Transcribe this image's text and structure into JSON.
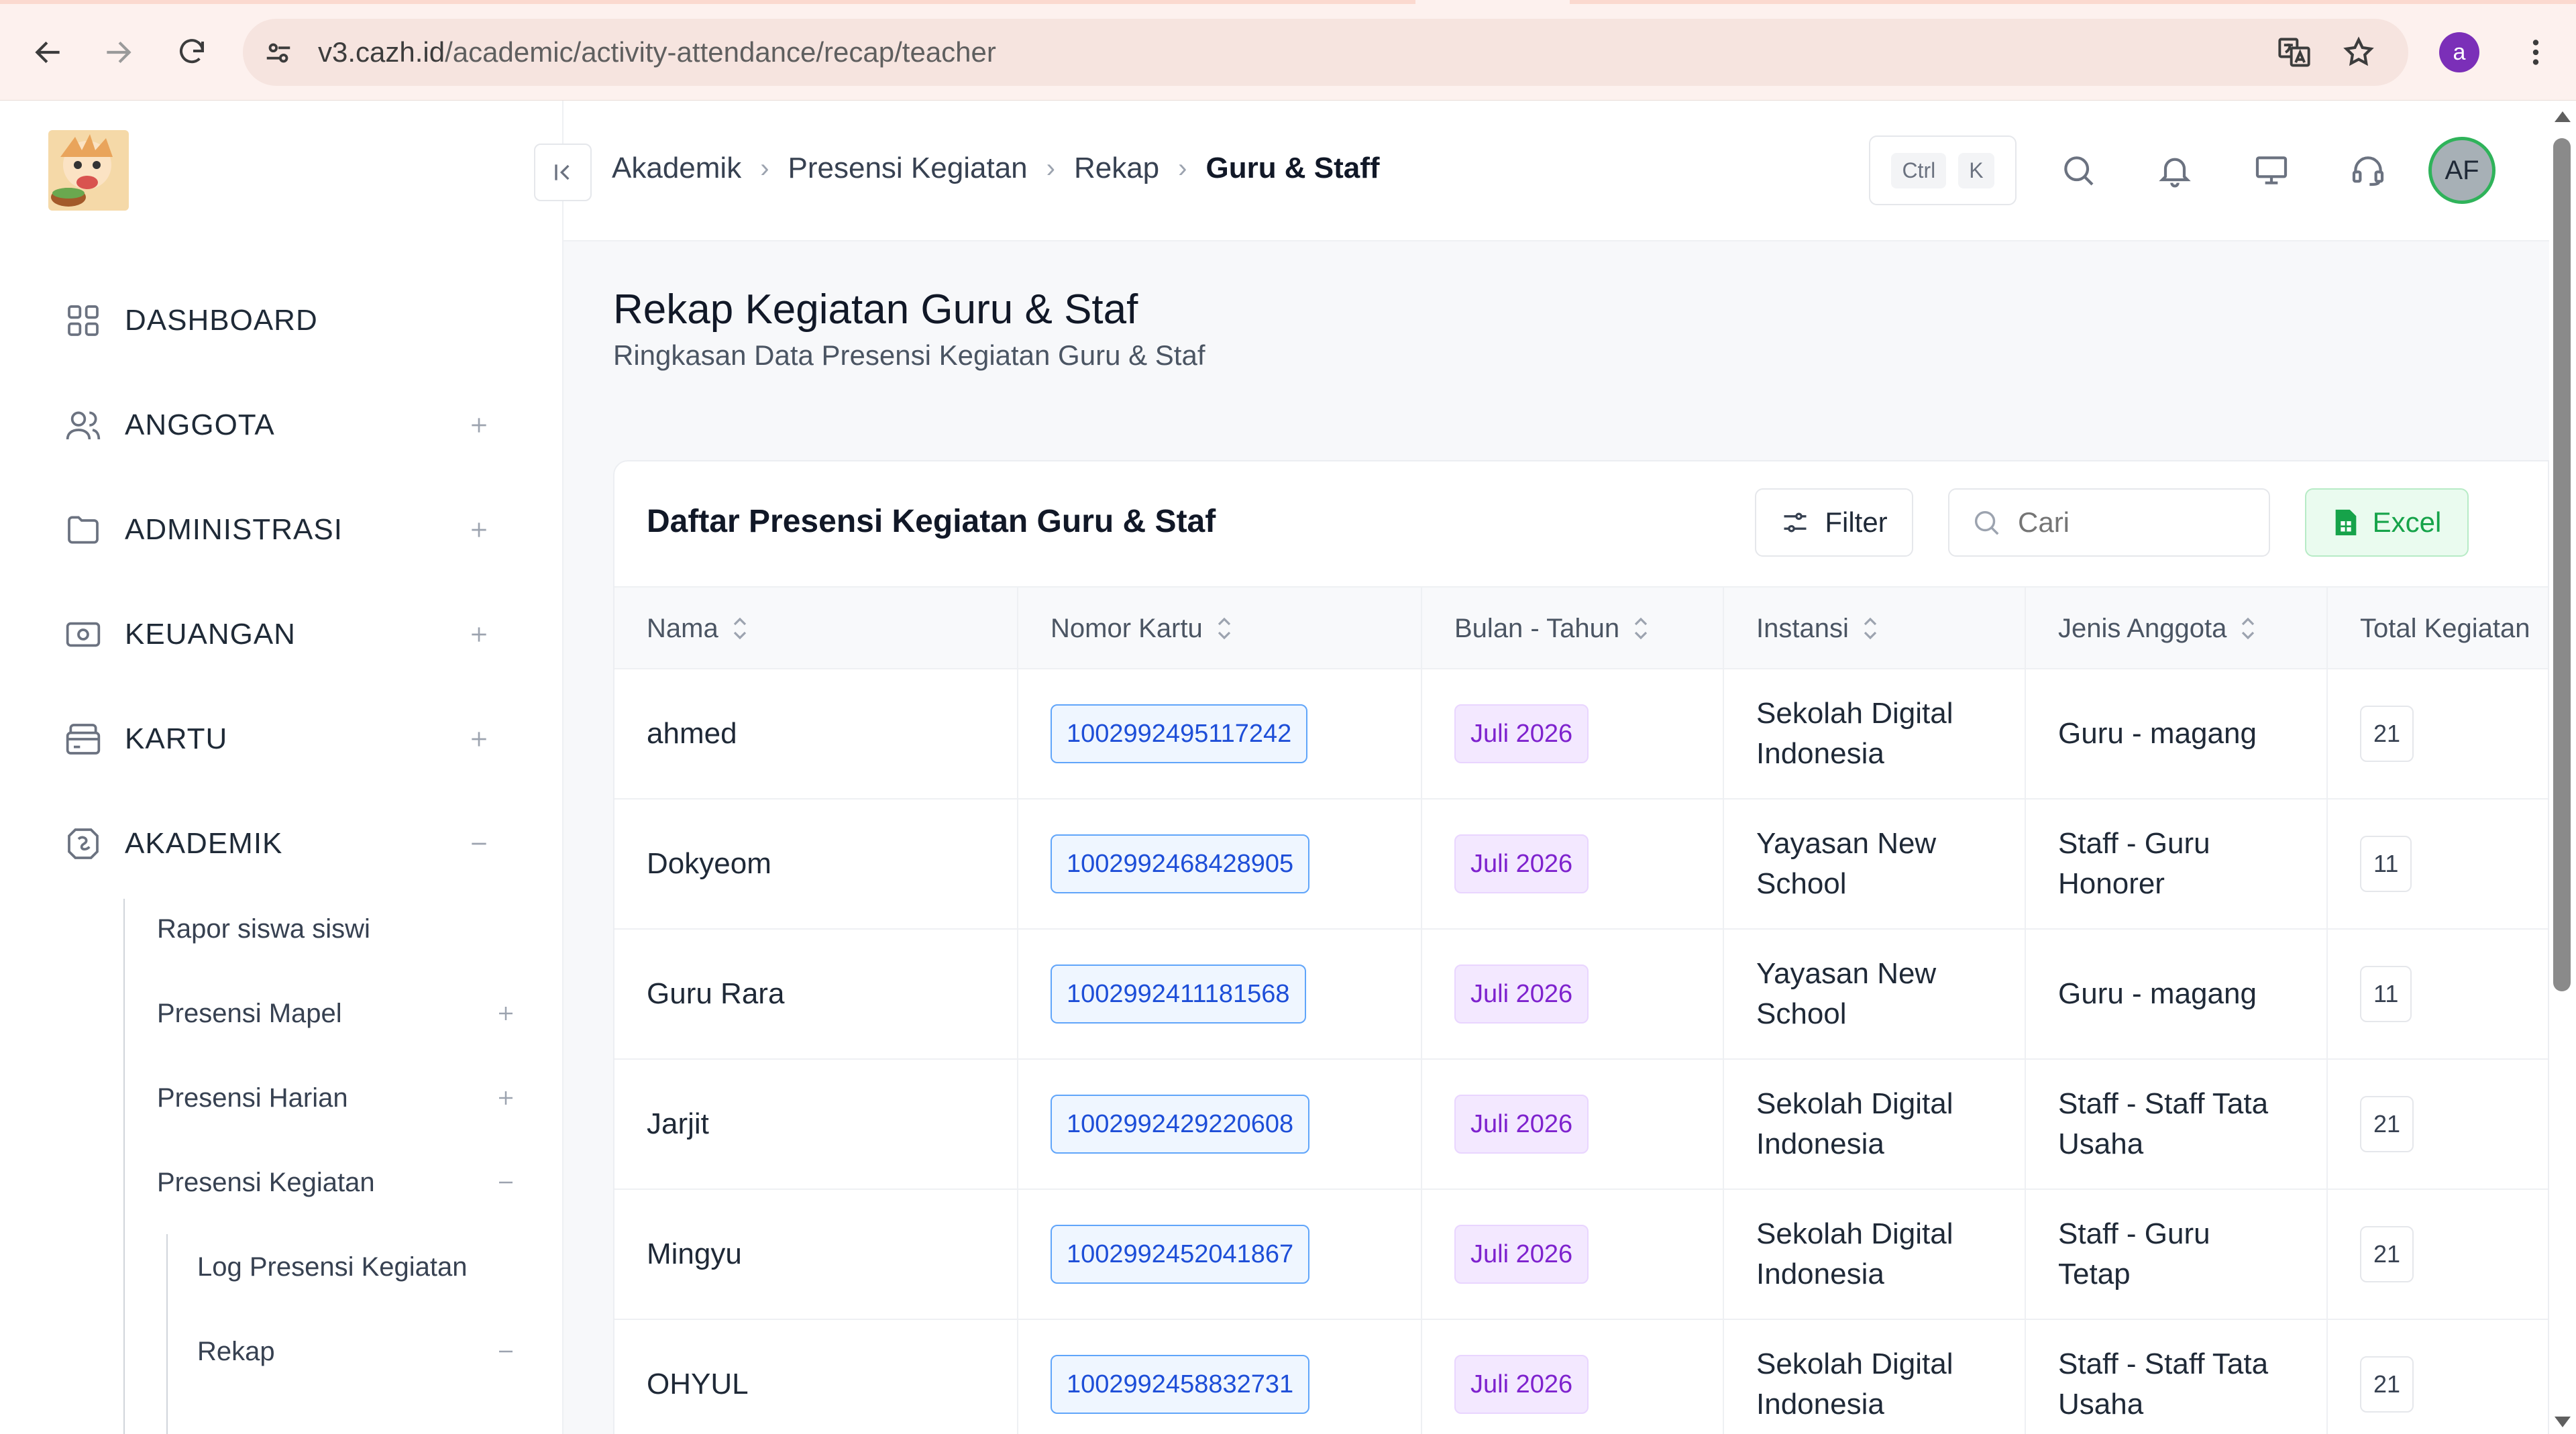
{
  "browser": {
    "url_host": "v3.cazh.id",
    "url_path": "/academic/activity-attendance/recap/teacher",
    "profile_initial": "a"
  },
  "sidebar": {
    "items": [
      {
        "label": "DASHBOARD",
        "icon": "grid-icon",
        "expand": "none"
      },
      {
        "label": "ANGGOTA",
        "icon": "users-icon",
        "expand": "plus"
      },
      {
        "label": "ADMINISTRASI",
        "icon": "folder-icon",
        "expand": "plus"
      },
      {
        "label": "KEUANGAN",
        "icon": "money-icon",
        "expand": "plus"
      },
      {
        "label": "KARTU",
        "icon": "card-icon",
        "expand": "plus"
      },
      {
        "label": "AKADEMIK",
        "icon": "academic-icon",
        "expand": "minus"
      }
    ],
    "akademik_sub": [
      {
        "label": "Rapor siswa siswi",
        "expand": "none"
      },
      {
        "label": "Presensi Mapel",
        "expand": "plus"
      },
      {
        "label": "Presensi Harian",
        "expand": "plus"
      },
      {
        "label": "Presensi Kegiatan",
        "expand": "minus"
      }
    ],
    "kegiatan_sub": [
      {
        "label": "Log Presensi Kegiatan",
        "expand": "none"
      },
      {
        "label": "Rekap",
        "expand": "minus"
      }
    ]
  },
  "topbar": {
    "breadcrumbs": [
      "Akademik",
      "Presensi Kegiatan",
      "Rekap",
      "Guru & Staff"
    ],
    "shortcut_keys": [
      "Ctrl",
      "K"
    ],
    "avatar_initials": "AF",
    "accent_color": "#2fb35a"
  },
  "page": {
    "title": "Rekap Kegiatan Guru & Staf",
    "subtitle": "Ringkasan Data Presensi Kegiatan Guru & Staf"
  },
  "table_card": {
    "title": "Daftar Presensi Kegiatan Guru & Staf",
    "filter_label": "Filter",
    "search_placeholder": "Cari",
    "excel_label": "Excel",
    "columns": [
      "Nama",
      "Nomor Kartu",
      "Bulan - Tahun",
      "Instansi",
      "Jenis Anggota",
      "Total Kegiatan"
    ],
    "rows": [
      {
        "nama": "ahmed",
        "nomor_kartu": "1002992495117242",
        "bulan_tahun": "Juli 2026",
        "instansi": "Sekolah Digital Indonesia",
        "jenis_anggota": "Guru - magang",
        "total": "21"
      },
      {
        "nama": "Dokyeom",
        "nomor_kartu": "1002992468428905",
        "bulan_tahun": "Juli 2026",
        "instansi": "Yayasan New School",
        "jenis_anggota": "Staff - Guru Honorer",
        "total": "11"
      },
      {
        "nama": "Guru Rara",
        "nomor_kartu": "1002992411181568",
        "bulan_tahun": "Juli 2026",
        "instansi": "Yayasan New School",
        "jenis_anggota": "Guru - magang",
        "total": "11"
      },
      {
        "nama": "Jarjit",
        "nomor_kartu": "1002992429220608",
        "bulan_tahun": "Juli 2026",
        "instansi": "Sekolah Digital Indonesia",
        "jenis_anggota": "Staff - Staff Tata Usaha",
        "total": "21"
      },
      {
        "nama": "Mingyu",
        "nomor_kartu": "1002992452041867",
        "bulan_tahun": "Juli 2026",
        "instansi": "Sekolah Digital Indonesia",
        "jenis_anggota": "Staff - Guru Tetap",
        "total": "21"
      },
      {
        "nama": "OHYUL",
        "nomor_kartu": "1002992458832731",
        "bulan_tahun": "Juli 2026",
        "instansi": "Sekolah Digital Indonesia",
        "jenis_anggota": "Staff - Staff Tata Usaha",
        "total": "21"
      }
    ]
  }
}
